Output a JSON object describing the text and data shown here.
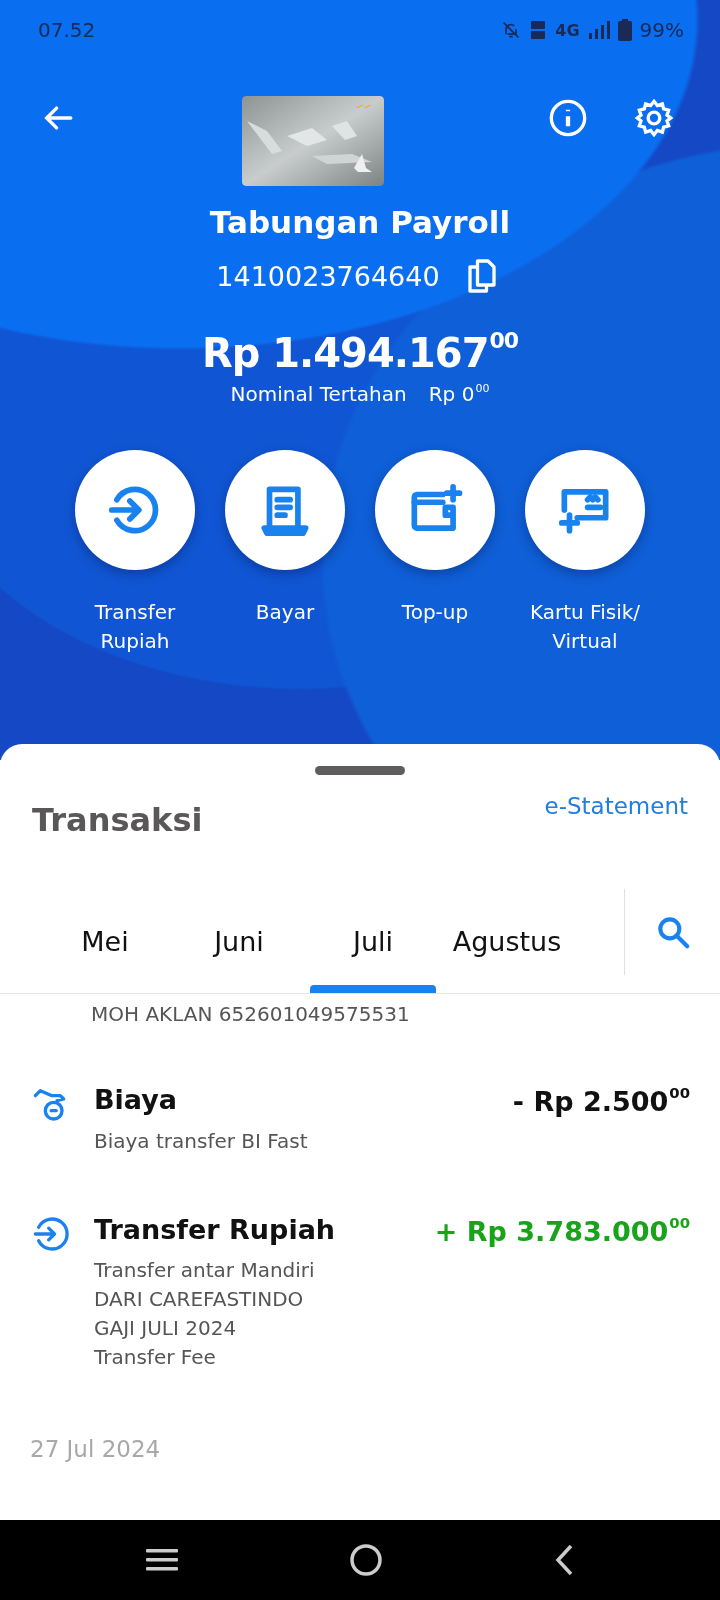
{
  "status_bar": {
    "time": "07.52",
    "network": "4G",
    "battery": "99%"
  },
  "account": {
    "name": "Tabungan Payroll",
    "number": "1410023764640",
    "balance": "Rp 1.494.167$^{00}$",
    "held_label": "Nominal Tertahan",
    "held_amount": "Rp 0$^{00}$"
  },
  "actions": [
    {
      "kind": "transfer",
      "label": "Transfer Rupiah"
    },
    {
      "kind": "pay",
      "label": "Bayar"
    },
    {
      "kind": "topup",
      "label": "Top-up"
    },
    {
      "kind": "card",
      "label": "Kartu Fisik/ Virtual"
    }
  ],
  "transactions_panel": {
    "title": "Transaksi",
    "link": "e-Statement",
    "tabs": [
      {
        "label": "Mei",
        "selected": false
      },
      {
        "label": "Juni",
        "selected": false
      },
      {
        "label": "Juli",
        "selected": true
      },
      {
        "label": "Agustus",
        "selected": false
      }
    ],
    "partial_line": "MOH AKLAN 652601049575531",
    "items": [
      {
        "kind": "debit",
        "title": "Biaya",
        "amount": "- Rp 2.500$^{00}$",
        "details": [
          "Biaya transfer BI Fast"
        ]
      },
      {
        "kind": "credit",
        "title": "Transfer Rupiah",
        "amount": "+ Rp 3.783.000$^{00}$",
        "details": [
          "Transfer antar Mandiri",
          "DARI CAREFASTINDO",
          "GAJI JULI 2024",
          "Transfer Fee"
        ]
      }
    ],
    "date_header": "27 Jul 2024"
  }
}
